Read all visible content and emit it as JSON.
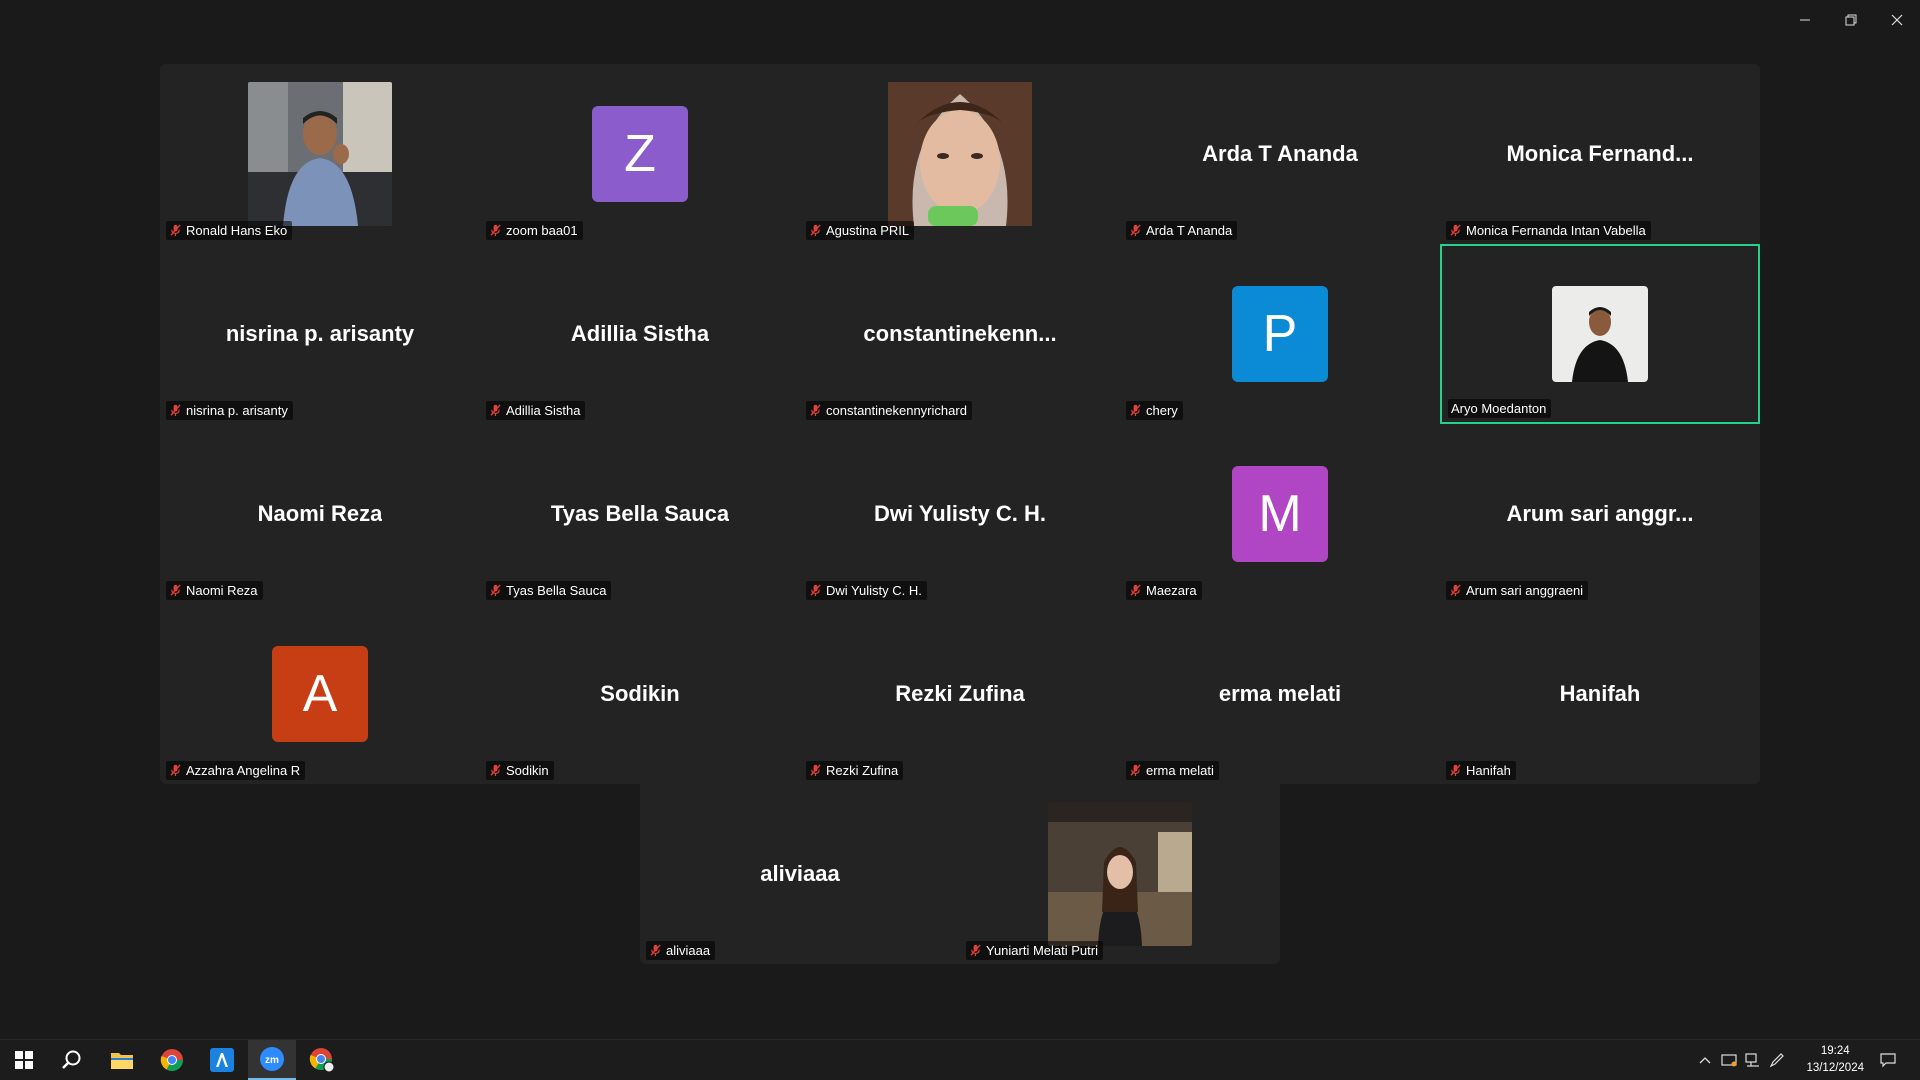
{
  "window": {
    "minimize_label": "—",
    "restore_label": "❐",
    "close_label": "✕"
  },
  "tiles": [
    {
      "name": "Ronald Hans Eko",
      "display": "photo-man"
    },
    {
      "name": "zoom baa01",
      "display": "avatar",
      "initial": "Z",
      "color": "#8b5ccc"
    },
    {
      "name": "Agustina PRIL",
      "display": "photo-woman"
    },
    {
      "name": "Arda T Ananda",
      "display": "text",
      "big": "Arda T Ananda"
    },
    {
      "name": "Monica Fernanda Intan Vabella",
      "display": "text",
      "big": "Monica  Fernand..."
    },
    {
      "name": "nisrina p. arisanty",
      "display": "text",
      "big": "nisrina p. arisanty"
    },
    {
      "name": "Adillia Sistha",
      "display": "text",
      "big": "Adillia Sistha"
    },
    {
      "name": "constantinekennyrichard",
      "display": "text",
      "big": "constantinekenn..."
    },
    {
      "name": "chery",
      "display": "avatar",
      "initial": "P",
      "color": "#0b8ad6"
    },
    {
      "name": "Aryo Moedanton",
      "display": "photo-aryo",
      "active": true,
      "unmuted": true
    },
    {
      "name": "Naomi Reza",
      "display": "text",
      "big": "Naomi Reza"
    },
    {
      "name": "Tyas Bella Sauca",
      "display": "text",
      "big": "Tyas Bella Sauca"
    },
    {
      "name": "Dwi Yulisty C. H.",
      "display": "text",
      "big": "Dwi Yulisty C. H."
    },
    {
      "name": "Maezara",
      "display": "avatar",
      "initial": "M",
      "color": "#b046c4"
    },
    {
      "name": "Arum sari anggraeni",
      "display": "text",
      "big": "Arum sari anggr..."
    },
    {
      "name": "Azzahra Angelina R",
      "display": "avatar",
      "initial": "A",
      "color": "#c73e14"
    },
    {
      "name": "Sodikin",
      "display": "text",
      "big": "Sodikin"
    },
    {
      "name": "Rezki Zufina",
      "display": "text",
      "big": "Rezki Zufina"
    },
    {
      "name": "erma melati",
      "display": "text",
      "big": "erma melati"
    },
    {
      "name": "Hanifah",
      "display": "text",
      "big": "Hanifah"
    },
    {
      "name": "aliviaaa",
      "display": "text",
      "big": "aliviaaa"
    },
    {
      "name": "Yuniarti Melati Putri",
      "display": "photo-yuniarti"
    }
  ],
  "colors": {
    "mute": "#e8413c",
    "active_border": "#23d28b"
  },
  "taskbar": {
    "apps": [
      "windows-start-icon",
      "search-icon",
      "file-explorer-icon",
      "chrome-icon",
      "azure-app-icon",
      "zoom-icon",
      "chrome-profile-icon"
    ],
    "active_app": "zoom-icon",
    "time": "19:24",
    "date": "13/12/2024"
  }
}
